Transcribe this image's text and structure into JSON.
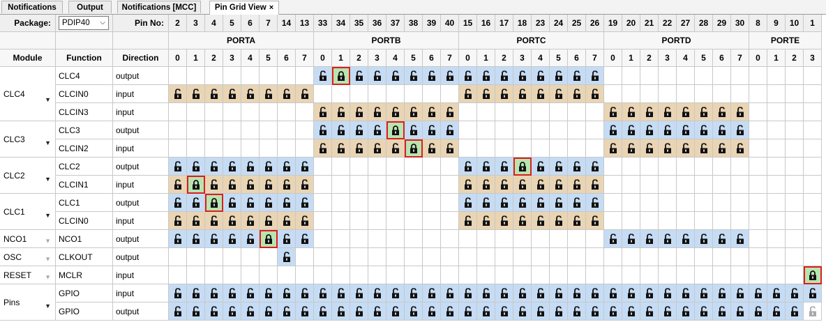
{
  "tabs": [
    {
      "label": "Notifications",
      "active": false,
      "closable": false
    },
    {
      "label": "Output",
      "active": false,
      "closable": false
    },
    {
      "label": "Notifications [MCC]",
      "active": false,
      "closable": false
    },
    {
      "label": "Pin Grid View",
      "active": true,
      "closable": true
    }
  ],
  "close_glyph": "×",
  "header": {
    "package_label": "Package:",
    "package_value": "PDIP40",
    "pin_no_label": "Pin No:",
    "module_label": "Module",
    "function_label": "Function",
    "direction_label": "Direction"
  },
  "ports": [
    {
      "name": "PORTA",
      "pins": [
        "2",
        "3",
        "4",
        "5",
        "6",
        "7",
        "14",
        "13"
      ],
      "bits": [
        "0",
        "1",
        "2",
        "3",
        "4",
        "5",
        "6",
        "7"
      ]
    },
    {
      "name": "PORTB",
      "pins": [
        "33",
        "34",
        "35",
        "36",
        "37",
        "38",
        "39",
        "40"
      ],
      "bits": [
        "0",
        "1",
        "2",
        "3",
        "4",
        "5",
        "6",
        "7"
      ]
    },
    {
      "name": "PORTC",
      "pins": [
        "15",
        "16",
        "17",
        "18",
        "23",
        "24",
        "25",
        "26"
      ],
      "bits": [
        "0",
        "1",
        "2",
        "3",
        "4",
        "5",
        "6",
        "7"
      ]
    },
    {
      "name": "PORTD",
      "pins": [
        "19",
        "20",
        "21",
        "22",
        "27",
        "28",
        "29",
        "30"
      ],
      "bits": [
        "0",
        "1",
        "2",
        "3",
        "4",
        "5",
        "6",
        "7"
      ]
    },
    {
      "name": "PORTE",
      "pins": [
        "8",
        "9",
        "10",
        "1"
      ],
      "bits": [
        "0",
        "1",
        "2",
        "3"
      ]
    }
  ],
  "modules": [
    {
      "name": "CLC4",
      "expandable": true,
      "enabled": true,
      "rows": [
        {
          "function": "CLC4",
          "direction": "output",
          "cells": [
            {
              "range": [
                8,
                15
              ],
              "style": "blue"
            },
            {
              "range": [
                16,
                23
              ],
              "style": "blue"
            }
          ],
          "special": [
            {
              "col": 9,
              "style": "green",
              "locked": true,
              "highlight": true
            }
          ]
        },
        {
          "function": "CLCIN0",
          "direction": "input",
          "cells": [
            {
              "range": [
                0,
                7
              ],
              "style": "tan"
            },
            {
              "range": [
                16,
                23
              ],
              "style": "tan"
            }
          ],
          "special": []
        },
        {
          "function": "CLCIN3",
          "direction": "input",
          "cells": [
            {
              "range": [
                8,
                15
              ],
              "style": "tan"
            },
            {
              "range": [
                24,
                31
              ],
              "style": "tan"
            }
          ],
          "special": []
        }
      ]
    },
    {
      "name": "CLC3",
      "expandable": true,
      "enabled": true,
      "rows": [
        {
          "function": "CLC3",
          "direction": "output",
          "cells": [
            {
              "range": [
                8,
                15
              ],
              "style": "blue"
            },
            {
              "range": [
                24,
                31
              ],
              "style": "blue"
            }
          ],
          "special": [
            {
              "col": 12,
              "style": "green",
              "locked": true,
              "highlight": true
            }
          ]
        },
        {
          "function": "CLCIN2",
          "direction": "input",
          "cells": [
            {
              "range": [
                8,
                15
              ],
              "style": "tan"
            },
            {
              "range": [
                24,
                31
              ],
              "style": "tan"
            }
          ],
          "special": [
            {
              "col": 13,
              "style": "green",
              "locked": true,
              "highlight": true
            }
          ]
        }
      ]
    },
    {
      "name": "CLC2",
      "expandable": true,
      "enabled": true,
      "rows": [
        {
          "function": "CLC2",
          "direction": "output",
          "cells": [
            {
              "range": [
                0,
                7
              ],
              "style": "blue"
            },
            {
              "range": [
                16,
                23
              ],
              "style": "blue"
            }
          ],
          "special": [
            {
              "col": 19,
              "style": "green",
              "locked": true,
              "highlight": true
            }
          ]
        },
        {
          "function": "CLCIN1",
          "direction": "input",
          "cells": [
            {
              "range": [
                0,
                7
              ],
              "style": "tan"
            },
            {
              "range": [
                16,
                23
              ],
              "style": "tan"
            }
          ],
          "special": [
            {
              "col": 1,
              "style": "green",
              "locked": true,
              "highlight": true
            }
          ]
        }
      ]
    },
    {
      "name": "CLC1",
      "expandable": true,
      "enabled": true,
      "rows": [
        {
          "function": "CLC1",
          "direction": "output",
          "cells": [
            {
              "range": [
                0,
                7
              ],
              "style": "blue"
            },
            {
              "range": [
                16,
                23
              ],
              "style": "blue"
            }
          ],
          "special": [
            {
              "col": 2,
              "style": "green",
              "locked": true,
              "highlight": true
            }
          ]
        },
        {
          "function": "CLCIN0",
          "direction": "input",
          "cells": [
            {
              "range": [
                0,
                7
              ],
              "style": "tan"
            },
            {
              "range": [
                16,
                23
              ],
              "style": "tan"
            }
          ],
          "special": []
        }
      ]
    },
    {
      "name": "NCO1",
      "expandable": false,
      "enabled": false,
      "rows": [
        {
          "function": "NCO1",
          "direction": "output",
          "cells": [
            {
              "range": [
                0,
                7
              ],
              "style": "blue"
            },
            {
              "range": [
                24,
                31
              ],
              "style": "blue"
            }
          ],
          "special": [
            {
              "col": 5,
              "style": "green",
              "locked": true,
              "highlight": true
            }
          ]
        }
      ]
    },
    {
      "name": "OSC",
      "expandable": false,
      "enabled": false,
      "rows": [
        {
          "function": "CLKOUT",
          "direction": "output",
          "cells": [
            {
              "range": [
                6,
                6
              ],
              "style": "blue"
            }
          ],
          "special": []
        }
      ]
    },
    {
      "name": "RESET",
      "expandable": false,
      "enabled": false,
      "rows": [
        {
          "function": "MCLR",
          "direction": "input",
          "cells": [],
          "special": [
            {
              "col": 35,
              "style": "green",
              "locked": true,
              "highlight": true
            }
          ]
        }
      ]
    },
    {
      "name": "Pins",
      "expandable": true,
      "enabled": true,
      "rows": [
        {
          "function": "GPIO",
          "direction": "input",
          "cells": [
            {
              "range": [
                0,
                35
              ],
              "style": "blue"
            }
          ],
          "special": []
        },
        {
          "function": "GPIO",
          "direction": "output",
          "cells": [
            {
              "range": [
                0,
                34
              ],
              "style": "blue"
            }
          ],
          "special": [
            {
              "col": 35,
              "style": "white",
              "locked": false,
              "greyed": true
            }
          ]
        }
      ]
    }
  ],
  "colors": {
    "output_available": "#c5dcf4",
    "input_available": "#e9d4b4",
    "locked_selected": "#b8e4b0",
    "selection_highlight": "#dc1e1e"
  },
  "icons": {
    "unlocked": "padlock-open-icon",
    "locked": "padlock-closed-icon",
    "expand": "dropdown-arrow-icon"
  }
}
